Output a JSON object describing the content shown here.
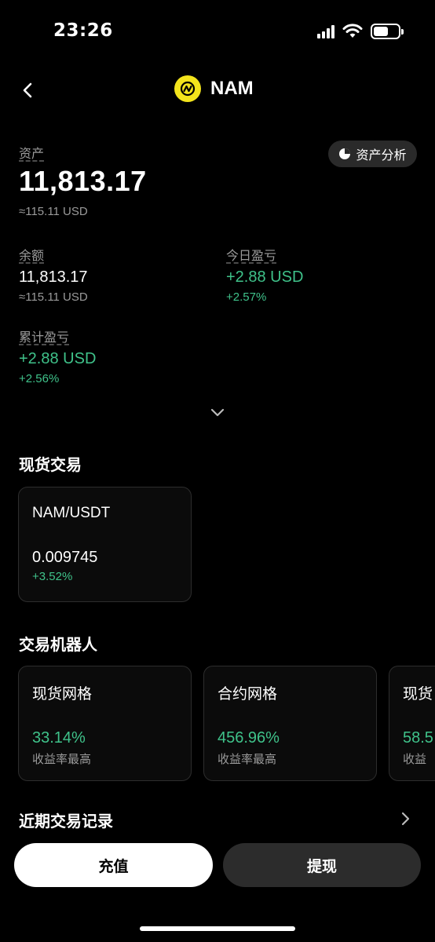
{
  "status": {
    "time": "23:26"
  },
  "header": {
    "title": "NAM"
  },
  "asset": {
    "label": "资产",
    "analysis_button": "资产分析",
    "value": "11,813.17",
    "usd": "≈115.11 USD"
  },
  "balance": {
    "label": "余额",
    "value": "11,813.17",
    "usd": "≈115.11 USD"
  },
  "today_pnl": {
    "label": "今日盈亏",
    "value": "+2.88 USD",
    "percent": "+2.57%"
  },
  "total_pnl": {
    "label": "累计盈亏",
    "value": "+2.88 USD",
    "percent": "+2.56%"
  },
  "spot": {
    "title": "现货交易",
    "cards": [
      {
        "pair": "NAM/USDT",
        "price": "0.009745",
        "change": "+3.52%"
      }
    ]
  },
  "bots": {
    "title": "交易机器人",
    "cards": [
      {
        "name": "现货网格",
        "rate": "33.14%",
        "desc": "收益率最高"
      },
      {
        "name": "合约网格",
        "rate": "456.96%",
        "desc": "收益率最高"
      },
      {
        "name": "现货",
        "rate": "58.5",
        "desc": "收益"
      }
    ]
  },
  "recent": {
    "title": "近期交易记录"
  },
  "actions": {
    "deposit": "充值",
    "withdraw": "提现"
  },
  "colors": {
    "accent_green": "#3fc28a",
    "coin_yellow": "#f3e41c"
  },
  "icons": [
    "signal-icon",
    "wifi-icon",
    "battery-icon",
    "back-arrow-icon",
    "nam-coin-logo",
    "pie-chart-icon",
    "chevron-down-icon",
    "chevron-right-icon"
  ]
}
